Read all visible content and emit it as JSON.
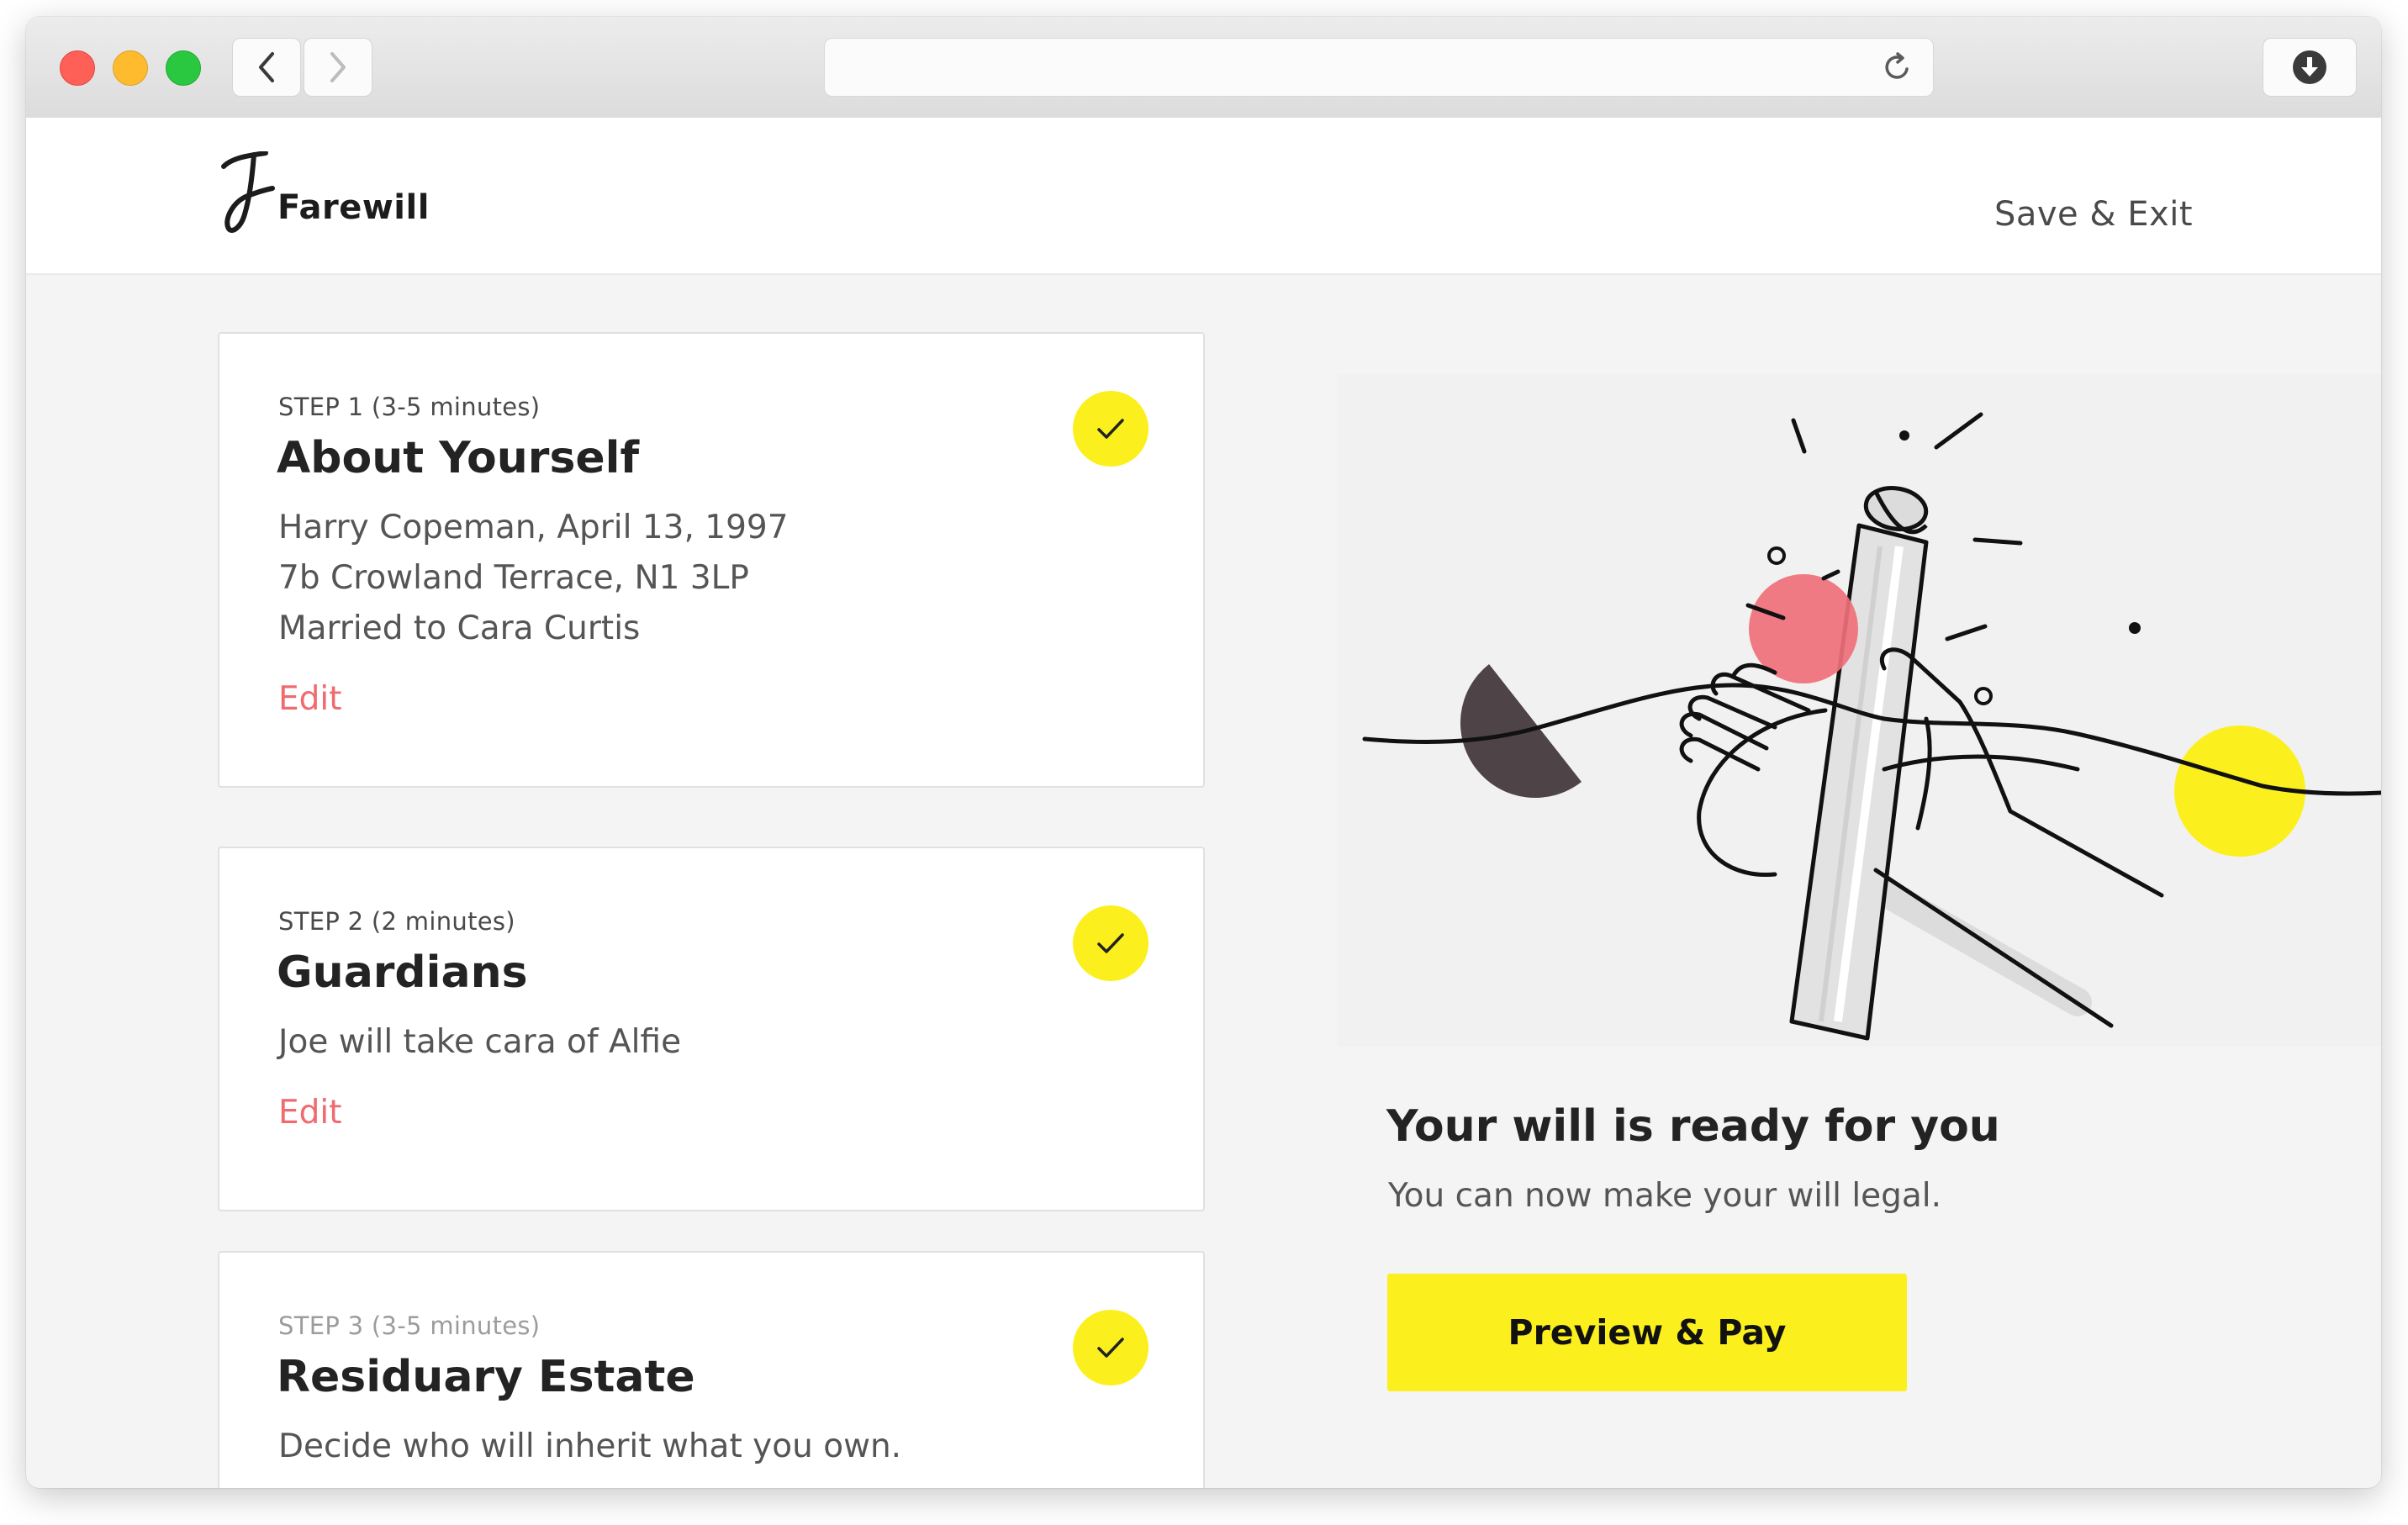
{
  "browser": {
    "url": "",
    "icons": [
      "back-arrow-icon",
      "forward-arrow-icon",
      "reload-icon",
      "download-icon"
    ]
  },
  "header": {
    "logo_text": "Farewill",
    "save_exit_label": "Save & Exit"
  },
  "steps": [
    {
      "meta": "STEP 1  (3-5 minutes)",
      "title": "About Yourself",
      "lines": [
        "Harry Copeman, April 13, 1997",
        "7b Crowland Terrace, N1 3LP",
        "Married to Cara Curtis"
      ],
      "edit_label": "Edit",
      "completed": true
    },
    {
      "meta": "STEP 2  (2 minutes)",
      "title": "Guardians",
      "lines": [
        "Joe will take cara of Alfie"
      ],
      "edit_label": "Edit",
      "completed": true
    },
    {
      "meta": "STEP 3  (3-5 minutes)",
      "title": "Residuary Estate",
      "lines": [
        "Decide who will inherit what you own."
      ],
      "completed": true
    }
  ],
  "ready": {
    "title": "Your will is ready for you",
    "subtitle": "You can now make your will legal.",
    "cta_label": "Preview & Pay"
  },
  "colors": {
    "accent_yellow": "#fbf01d",
    "edit_pink": "#ef6b70",
    "text_dark": "#232323",
    "page_bg": "#f4f4f4"
  }
}
